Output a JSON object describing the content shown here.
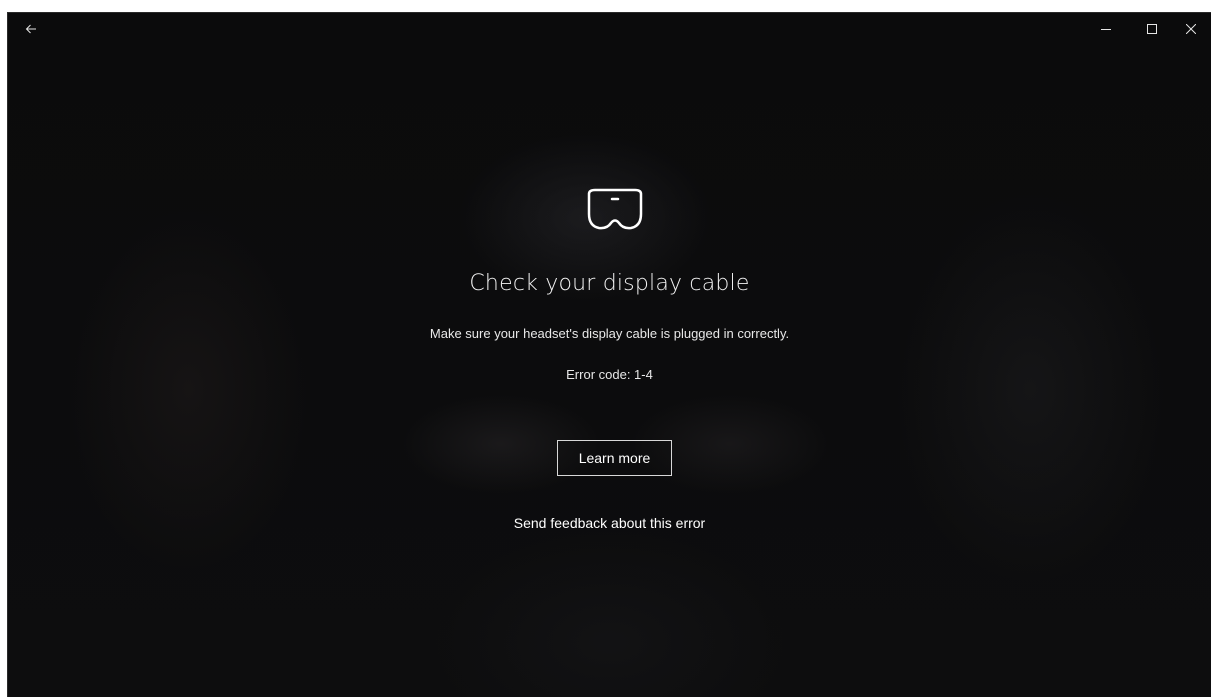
{
  "titlebar": {
    "back_icon": "arrow-left-icon",
    "minimize_icon": "minimize-icon",
    "maximize_icon": "maximize-icon",
    "close_icon": "close-icon"
  },
  "main": {
    "icon": "vr-headset-icon",
    "title": "Check your display cable",
    "message": "Make sure your headset's display cable is plugged in correctly.",
    "error_code": "Error code: 1-4",
    "learn_more_label": "Learn more",
    "feedback_label": "Send feedback about this error"
  },
  "colors": {
    "background": "#0a0a0b",
    "text": "#ffffff",
    "button_border": "#d8d8d8"
  }
}
